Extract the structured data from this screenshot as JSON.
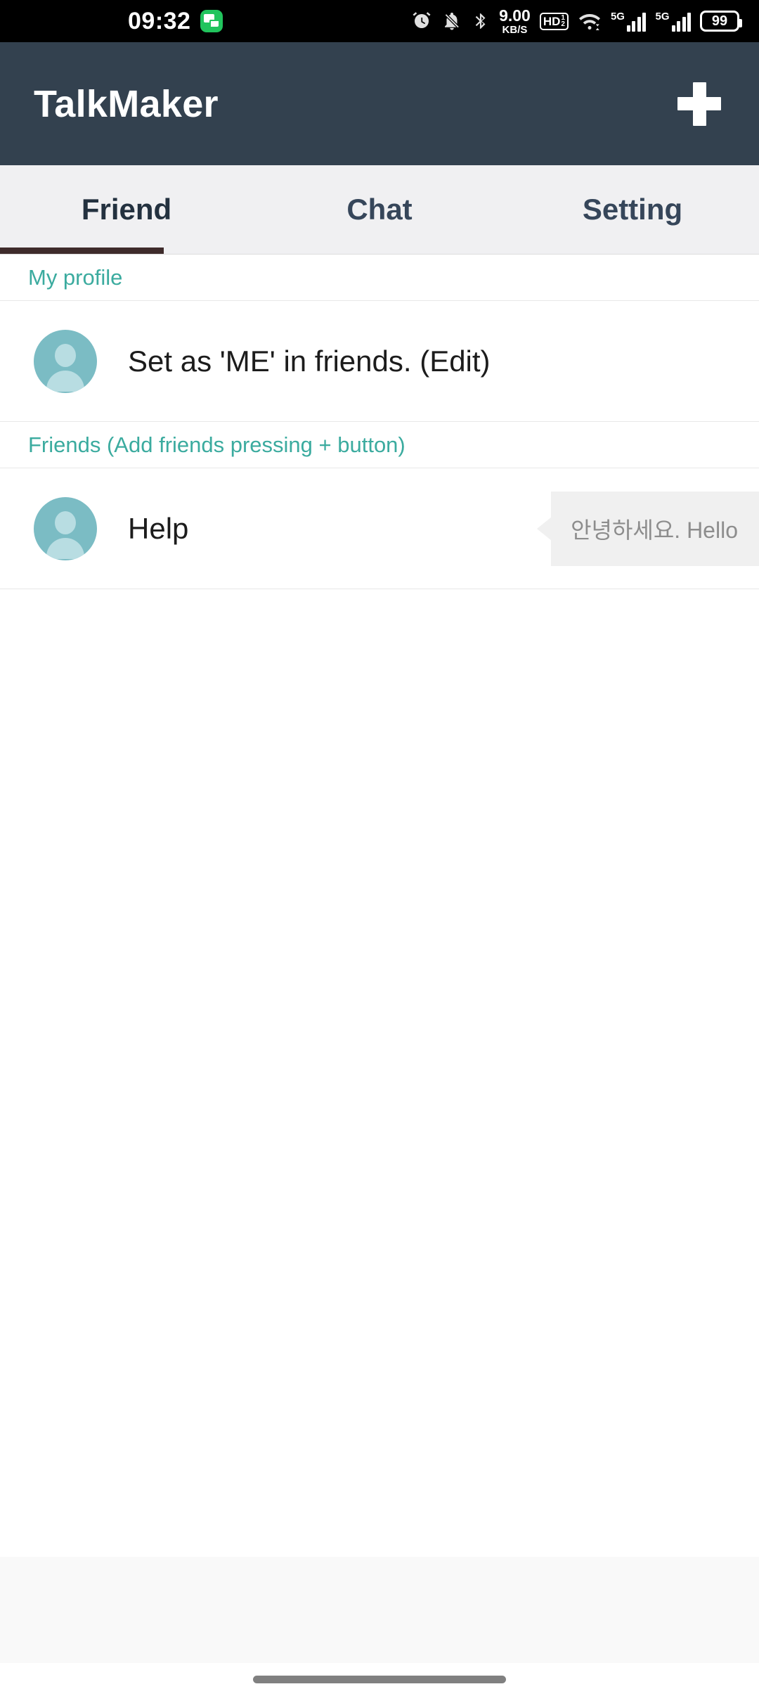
{
  "status_bar": {
    "time": "09:32",
    "app_icon": "messages-icon",
    "icons": [
      "alarm-icon",
      "bell-muted-icon",
      "bluetooth-icon",
      "hd-voice-icon",
      "wifi-icon",
      "signal-5g-sim1-icon",
      "signal-5g-sim2-icon",
      "battery-icon"
    ],
    "network_speed_value": "9.00",
    "network_speed_unit": "KB/S",
    "hd_label": "HD",
    "hd_sup": "1",
    "hd_sub": "2",
    "signal1_label": "5G",
    "signal2_label": "5G",
    "battery_level": "99"
  },
  "app_bar": {
    "title": "TalkMaker",
    "add_button_label": "+",
    "background_color": "#33414f"
  },
  "tabs": {
    "items": [
      {
        "label": "Friend",
        "active": true
      },
      {
        "label": "Chat",
        "active": false
      },
      {
        "label": "Setting",
        "active": false
      }
    ],
    "indicator_color": "#3e2b2b",
    "background_color": "#f0f0f2"
  },
  "sections": {
    "my_profile": {
      "header": "My profile",
      "accent_color": "#3bab9f",
      "row": {
        "avatar": "person-avatar",
        "name": "Set as 'ME' in friends. (Edit)"
      }
    },
    "friends": {
      "header": "Friends (Add friends pressing + button)",
      "accent_color": "#3bab9f",
      "rows": [
        {
          "avatar": "person-avatar",
          "name": "Help",
          "status_message": "안녕하세요. Hello"
        }
      ]
    }
  },
  "bottom": {
    "ad_band_color": "#f9f9f9",
    "nav_pill": "home-gesture-pill"
  }
}
